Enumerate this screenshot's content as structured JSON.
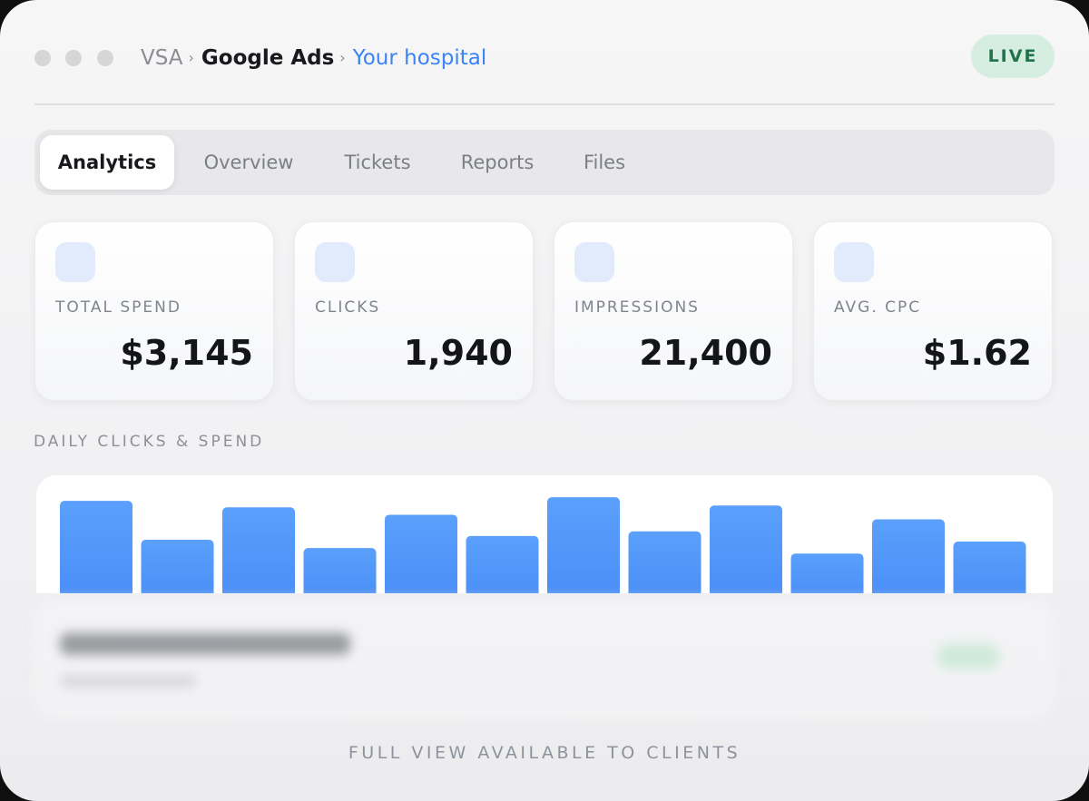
{
  "header": {
    "crumb_org": "VSA",
    "crumb_sep": "›",
    "crumb_section": "Google Ads",
    "crumb_client": "Your hospital",
    "status_badge": "LIVE"
  },
  "tabs": [
    {
      "label": "Analytics",
      "active": true
    },
    {
      "label": "Overview",
      "active": false
    },
    {
      "label": "Tickets",
      "active": false
    },
    {
      "label": "Reports",
      "active": false
    },
    {
      "label": "Files",
      "active": false
    }
  ],
  "stats": [
    {
      "label": "TOTAL SPEND",
      "value": "$3,145",
      "icon": "spend-icon"
    },
    {
      "label": "CLICKS",
      "value": "1,940",
      "icon": "clicks-icon"
    },
    {
      "label": "IMPRESSIONS",
      "value": "21,400",
      "icon": "impressions-icon"
    },
    {
      "label": "AVG. CPC",
      "value": "$1.62",
      "icon": "cpc-icon"
    }
  ],
  "chart_section_title": "DAILY CLICKS & SPEND",
  "chart_data": {
    "type": "bar",
    "title": "DAILY CLICKS & SPEND",
    "categories": [
      "",
      "",
      "",
      "",
      "",
      "",
      "",
      "",
      "",
      "",
      "",
      ""
    ],
    "values": [
      100,
      58,
      93,
      49,
      85,
      62,
      104,
      67,
      95,
      43,
      80,
      56
    ],
    "ylim": [
      0,
      110
    ],
    "grid": false,
    "color": "#4d92f8"
  },
  "footer_note": "FULL VIEW AVAILABLE TO CLIENTS",
  "colors": {
    "accent": "#3b82f6",
    "live_bg": "#d6eee1",
    "live_text": "#20734a",
    "bar": "#4d92f8"
  }
}
